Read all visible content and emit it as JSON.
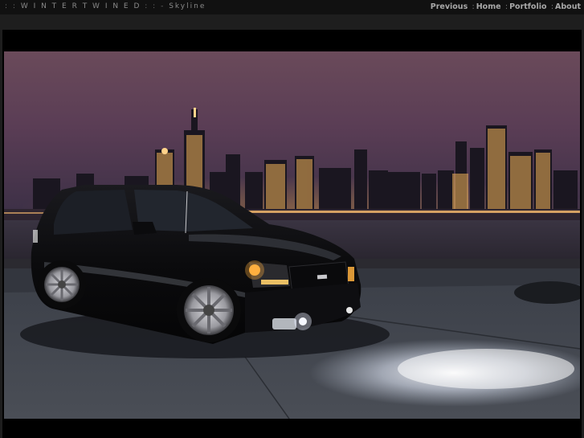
{
  "header": {
    "prefix": ": :",
    "site_name": "W I N T E R T W I N E D",
    "separator": ": : -",
    "page_name": "Skyline"
  },
  "nav": {
    "items": [
      {
        "label": "Previous"
      },
      {
        "label": "Home"
      },
      {
        "label": "Portfolio"
      },
      {
        "label": "About"
      }
    ],
    "separator": ":"
  },
  "photo": {
    "subject": "black SUV parked at night in front of city skyline"
  },
  "colors": {
    "page_bg": "#1e1e1e",
    "topbar_bg": "#111111",
    "frame_bg": "#000000",
    "nav_text": "#a8a8a8",
    "title_text": "#8a8a8a"
  }
}
